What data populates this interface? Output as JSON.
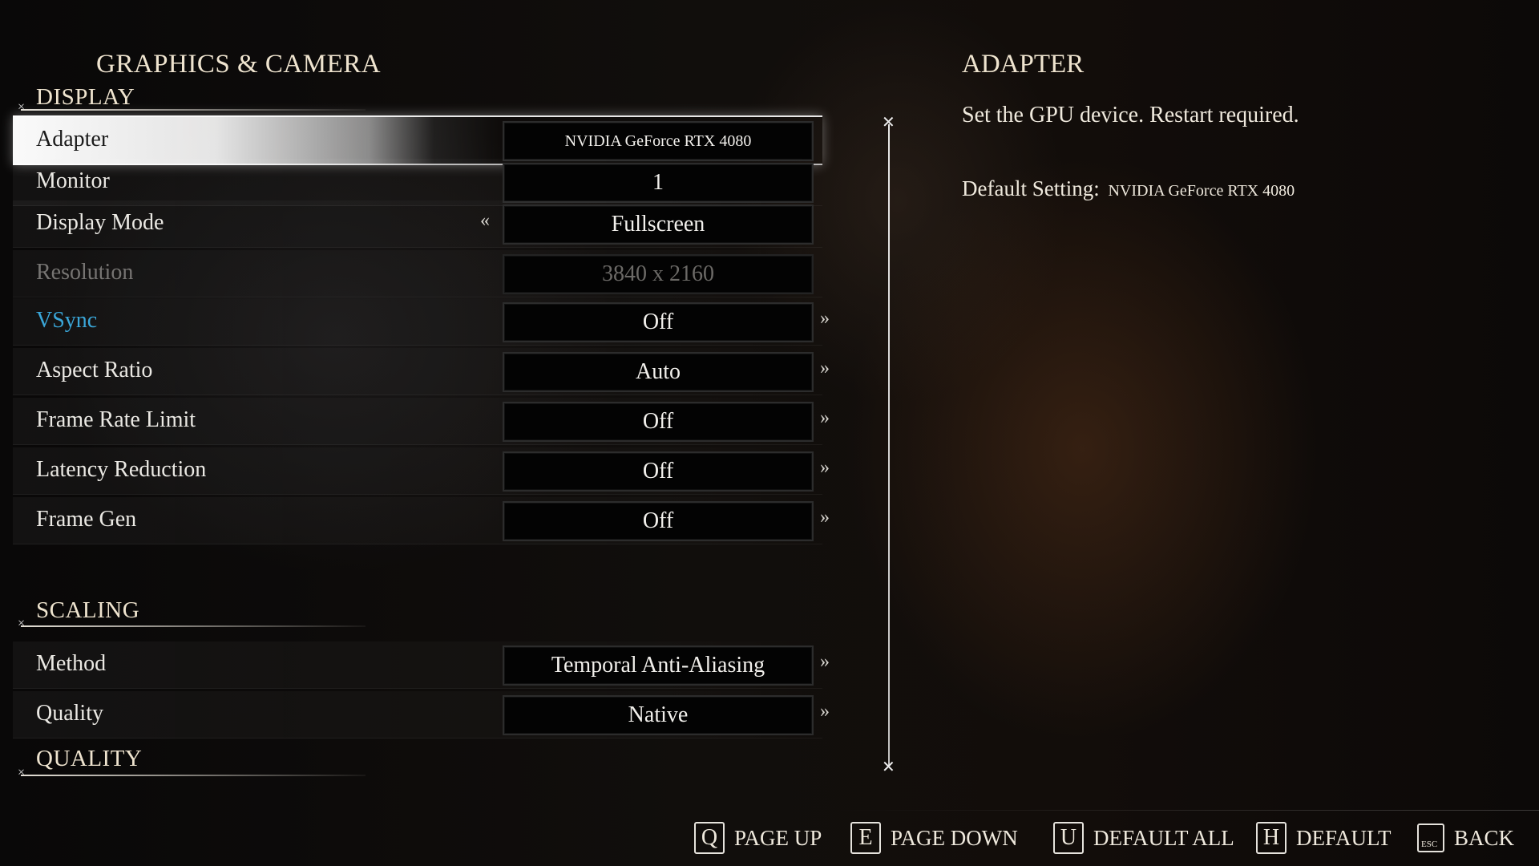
{
  "header": {
    "title": "GRAPHICS & CAMERA"
  },
  "sections": {
    "display": "DISPLAY",
    "scaling": "SCALING",
    "quality": "QUALITY"
  },
  "settings": [
    {
      "label": "Adapter",
      "value": "NVIDIA GeForce RTX 4080",
      "state": "selected"
    },
    {
      "label": "Monitor",
      "value": "1",
      "state": "normal"
    },
    {
      "label": "Display Mode",
      "value": "Fullscreen",
      "state": "normal"
    },
    {
      "label": "Resolution",
      "value": "3840 x 2160",
      "state": "disabled"
    },
    {
      "label": "VSync",
      "value": "Off",
      "state": "highlight"
    },
    {
      "label": "Aspect Ratio",
      "value": "Auto",
      "state": "normal"
    },
    {
      "label": "Frame Rate Limit",
      "value": "Off",
      "state": "normal"
    },
    {
      "label": "Latency Reduction",
      "value": "Off",
      "state": "normal"
    },
    {
      "label": "Frame Gen",
      "value": "Off",
      "state": "normal"
    },
    {
      "label": "Method",
      "value": "Temporal Anti-Aliasing",
      "state": "normal"
    },
    {
      "label": "Quality",
      "value": "Native",
      "state": "normal"
    }
  ],
  "arrows": {
    "left": "«",
    "right": "»"
  },
  "info": {
    "title": "ADAPTER",
    "description": "Set the GPU device. Restart required.",
    "default_label": "Default Setting:",
    "default_value": "NVIDIA GeForce RTX 4080"
  },
  "footer": {
    "page_up": {
      "key": "Q",
      "label": "PAGE UP"
    },
    "page_down": {
      "key": "E",
      "label": "PAGE DOWN"
    },
    "default_all": {
      "key": "U",
      "label": "DEFAULT ALL"
    },
    "default": {
      "key": "H",
      "label": "DEFAULT"
    },
    "back": {
      "key": "ESC",
      "label": "BACK"
    }
  },
  "colors": {
    "highlight": "#3aa6d8",
    "disabled": "#767472",
    "selected_row": "#ffffff"
  },
  "icons": {
    "section_marker": "cross-ornament-icon",
    "divider_cap": "ornament-icon"
  }
}
